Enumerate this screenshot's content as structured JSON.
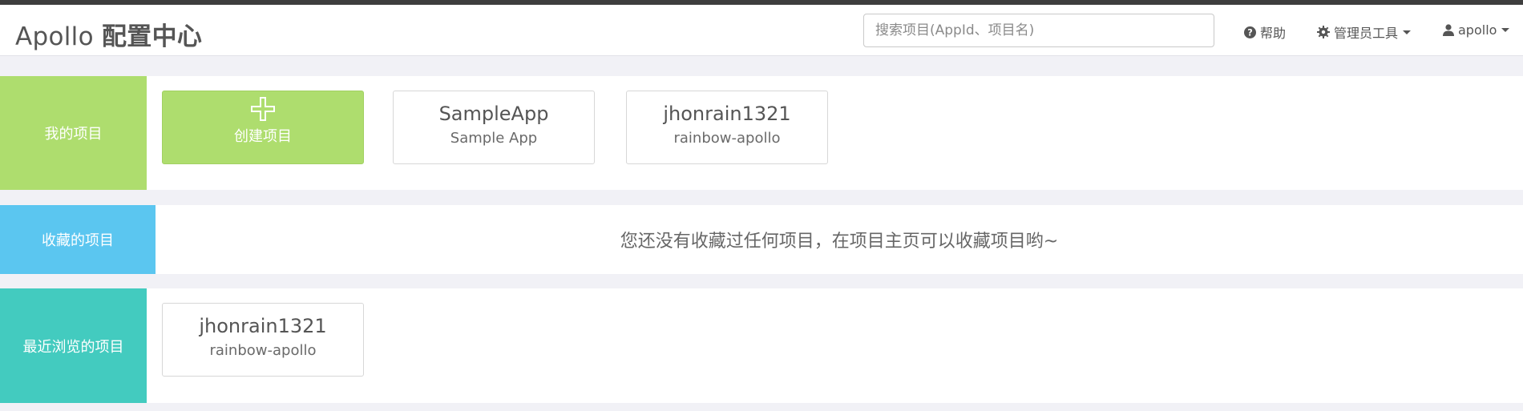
{
  "header": {
    "brand_prefix": "Apollo",
    "brand_suffix": "配置中心",
    "search_placeholder": "搜索项目(AppId、项目名)",
    "help_label": "帮助",
    "admin_tools_label": "管理员工具",
    "user_label": "apollo"
  },
  "sections": {
    "my_projects": {
      "label": "我的项目",
      "color": "#aedd6e",
      "create_label": "创建项目",
      "projects": [
        {
          "title": "SampleApp",
          "subtitle": "Sample App"
        },
        {
          "title": "jhonrain1321",
          "subtitle": "rainbow-apollo"
        }
      ]
    },
    "favorites": {
      "label": "收藏的项目",
      "color": "#5bc6f0",
      "empty_message": "您还没有收藏过任何项目，在项目主页可以收藏项目哟~"
    },
    "recent": {
      "label": "最近浏览的项目",
      "color": "#43cbbf",
      "projects": [
        {
          "title": "jhonrain1321",
          "subtitle": "rainbow-apollo"
        }
      ]
    }
  },
  "icons": {
    "help": "question-circle-icon",
    "admin": "gear-icon",
    "user": "user-icon",
    "create": "plus-icon"
  }
}
